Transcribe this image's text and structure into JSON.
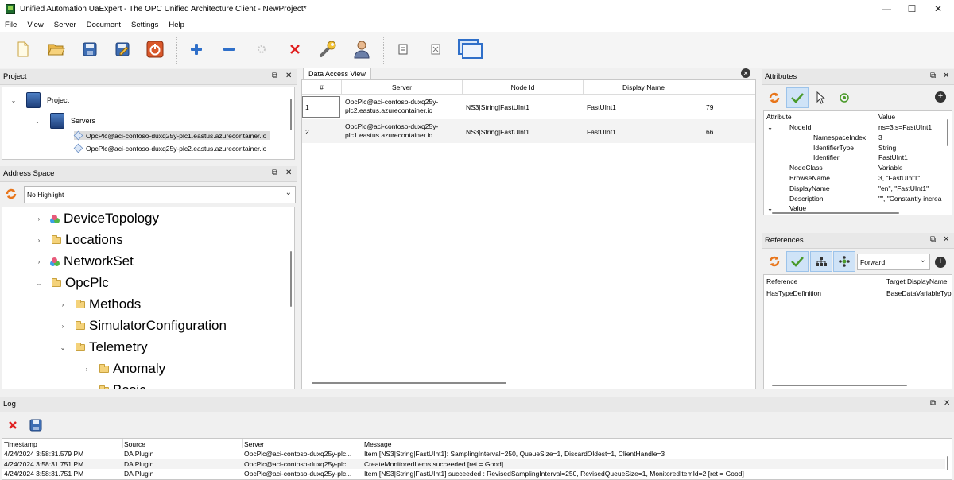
{
  "window": {
    "title": "Unified Automation UaExpert - The OPC Unified Architecture Client - NewProject*",
    "minimize": "—",
    "maximize": "☐",
    "close": "✕"
  },
  "menu": [
    "File",
    "View",
    "Server",
    "Document",
    "Settings",
    "Help"
  ],
  "project_panel": {
    "title": "Project",
    "tree": {
      "root": "Project",
      "servers": "Servers",
      "connections": [
        "OpcPlc@aci-contoso-duxq25y-plc1.eastus.azurecontainer.io",
        "OpcPlc@aci-contoso-duxq25y-plc2.eastus.azurecontainer.io"
      ]
    }
  },
  "address_space": {
    "title": "Address Space",
    "highlight": "No Highlight",
    "nodes": [
      {
        "label": "DeviceTopology",
        "chevron": "›"
      },
      {
        "label": "Locations",
        "chevron": "›"
      },
      {
        "label": "NetworkSet",
        "chevron": "›"
      },
      {
        "label": "OpcPlc",
        "chevron": "⌄"
      },
      {
        "label": "Methods",
        "chevron": "›"
      },
      {
        "label": "SimulatorConfiguration",
        "chevron": "›"
      },
      {
        "label": "Telemetry",
        "chevron": "⌄"
      },
      {
        "label": "Anomaly",
        "chevron": "›"
      },
      {
        "label": "Basic",
        "chevron": "›"
      }
    ]
  },
  "data_access": {
    "tab": "Data Access View",
    "columns": [
      "#",
      "Server",
      "Node Id",
      "Display Name",
      ""
    ],
    "rows": [
      {
        "num": "1",
        "server1": "OpcPlc@aci-contoso-duxq25y-",
        "server2": "plc2.eastus.azurecontainer.io",
        "node_id": "NS3|String|FastUInt1",
        "display_name": "FastUInt1",
        "value": "79"
      },
      {
        "num": "2",
        "server1": "OpcPlc@aci-contoso-duxq25y-",
        "server2": "plc1.eastus.azurecontainer.io",
        "node_id": "NS3|String|FastUInt1",
        "display_name": "FastUInt1",
        "value": "66"
      }
    ]
  },
  "attributes": {
    "title": "Attributes",
    "col_attr": "Attribute",
    "col_value": "Value",
    "rows": [
      {
        "name": "NodeId",
        "value": "ns=3;s=FastUInt1",
        "indent": 1,
        "chev": "⌄"
      },
      {
        "name": "NamespaceIndex",
        "value": "3",
        "indent": 2,
        "chev": ""
      },
      {
        "name": "IdentifierType",
        "value": "String",
        "indent": 2,
        "chev": ""
      },
      {
        "name": "Identifier",
        "value": "FastUInt1",
        "indent": 2,
        "chev": ""
      },
      {
        "name": "NodeClass",
        "value": "Variable",
        "indent": 1,
        "chev": ""
      },
      {
        "name": "BrowseName",
        "value": "3, \"FastUInt1\"",
        "indent": 1,
        "chev": ""
      },
      {
        "name": "DisplayName",
        "value": "\"en\", \"FastUInt1\"",
        "indent": 1,
        "chev": ""
      },
      {
        "name": "Description",
        "value": "\"\", \"Constantly increa",
        "indent": 1,
        "chev": ""
      },
      {
        "name": "Value",
        "value": "",
        "indent": 1,
        "chev": "⌄"
      }
    ]
  },
  "references": {
    "title": "References",
    "direction": "Forward",
    "col_ref": "Reference",
    "col_target": "Target DisplayName",
    "rows": [
      {
        "ref": "HasTypeDefinition",
        "target": "BaseDataVariableType"
      }
    ]
  },
  "log": {
    "title": "Log",
    "columns": [
      "Timestamp",
      "Source",
      "Server",
      "Message"
    ],
    "rows": [
      {
        "ts": "4/24/2024 3:58:31.579 PM",
        "source": "DA Plugin",
        "server": "OpcPlc@aci-contoso-duxq25y-plc...",
        "msg": "Item [NS3|String|FastUInt1]: SamplingInterval=250, QueueSize=1, DiscardOldest=1, ClientHandle=3"
      },
      {
        "ts": "4/24/2024 3:58:31.751 PM",
        "source": "DA Plugin",
        "server": "OpcPlc@aci-contoso-duxq25y-plc...",
        "msg": "CreateMonitoredItems succeeded [ret = Good]"
      },
      {
        "ts": "4/24/2024 3:58:31.751 PM",
        "source": "DA Plugin",
        "server": "OpcPlc@aci-contoso-duxq25y-plc...",
        "msg": "Item [NS3|String|FastUInt1] succeeded : RevisedSamplingInterval=250, RevisedQueueSize=1, MonitoredItemId=2 [ret = Good]"
      }
    ]
  },
  "controls": {
    "float": "⧉",
    "close": "✕"
  },
  "colors": {
    "accent_blue": "#2f6fc9",
    "selection": "#cce4f7",
    "toolbar_bg": "#f5f5f5"
  }
}
